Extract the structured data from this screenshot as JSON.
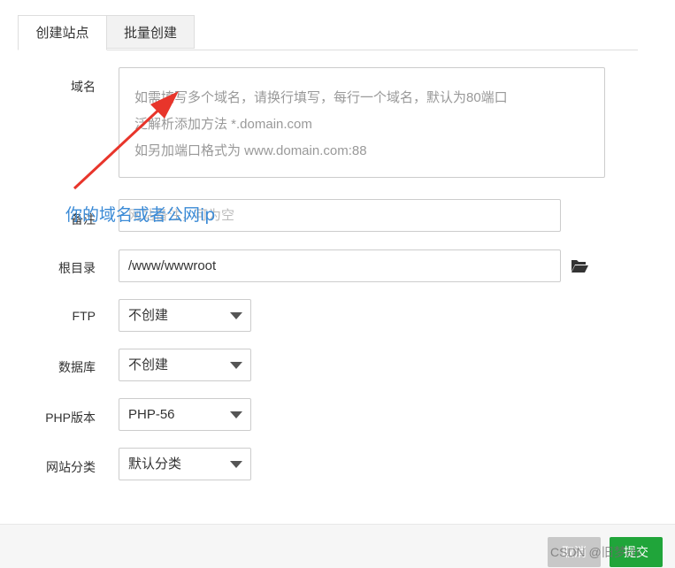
{
  "tabs": [
    {
      "label": "创建站点",
      "active": true
    },
    {
      "label": "批量创建",
      "active": false
    }
  ],
  "form": {
    "domain": {
      "label": "域名",
      "placeholder_lines": [
        "如需填写多个域名，请换行填写，每行一个域名，默认为80端口",
        "泛解析添加方法 *.domain.com",
        "如另加端口格式为 www.domain.com:88"
      ]
    },
    "remark": {
      "label": "备注",
      "placeholder": "网站备注，可为空"
    },
    "root": {
      "label": "根目录",
      "value": "/www/wwwroot",
      "icon": "folder-open-icon"
    },
    "ftp": {
      "label": "FTP",
      "value": "不创建"
    },
    "database": {
      "label": "数据库",
      "value": "不创建"
    },
    "php": {
      "label": "PHP版本",
      "value": "PHP-56"
    },
    "category": {
      "label": "网站分类",
      "value": "默认分类"
    }
  },
  "annotation": {
    "text": "你的域名或者公网ip",
    "color": "#3a8ad6",
    "arrow_color": "#e8352b"
  },
  "footer": {
    "cancel_label": "取消",
    "submit_label": "提交"
  },
  "watermark": "CSDN @旧梦ch.",
  "colors": {
    "primary": "#20a53a",
    "cancel": "#c8c8c8"
  }
}
